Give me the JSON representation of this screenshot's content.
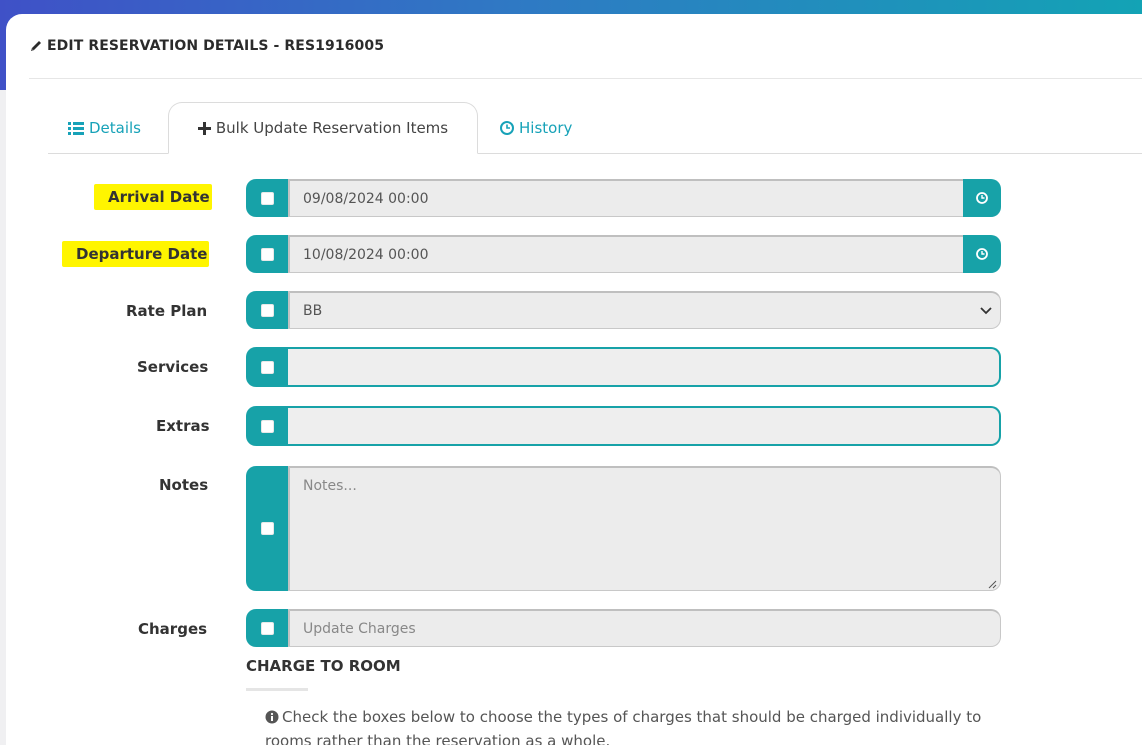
{
  "modal": {
    "title": "EDIT RESERVATION DETAILS - RES1916005"
  },
  "tabs": [
    {
      "label": "Details",
      "icon": "list-icon",
      "active": false
    },
    {
      "label": "Bulk Update Reservation Items",
      "icon": "plus-icon",
      "active": true
    },
    {
      "label": "History",
      "icon": "clock-icon",
      "active": false
    }
  ],
  "form": {
    "arrival_date": {
      "label": "Arrival Date",
      "value": "09/08/2024 00:00",
      "highlighted": true
    },
    "departure_date": {
      "label": "Departure Date",
      "value": "10/08/2024 00:00",
      "highlighted": true
    },
    "rate_plan": {
      "label": "Rate Plan",
      "value": "BB"
    },
    "services": {
      "label": "Services",
      "value": ""
    },
    "extras": {
      "label": "Extras",
      "value": ""
    },
    "notes": {
      "label": "Notes",
      "placeholder": "Notes..."
    },
    "charges": {
      "label": "Charges",
      "placeholder": "Update Charges"
    }
  },
  "charge_to_room": {
    "title": "CHARGE TO ROOM",
    "info": "Check the boxes below to choose the types of charges that should be charged individually to rooms rather than the reservation as a whole."
  },
  "colors": {
    "accent": "#17a2a8",
    "highlight": "#fff500",
    "header_gradient_start": "#3f51c7",
    "header_gradient_end": "#13a3b5"
  }
}
